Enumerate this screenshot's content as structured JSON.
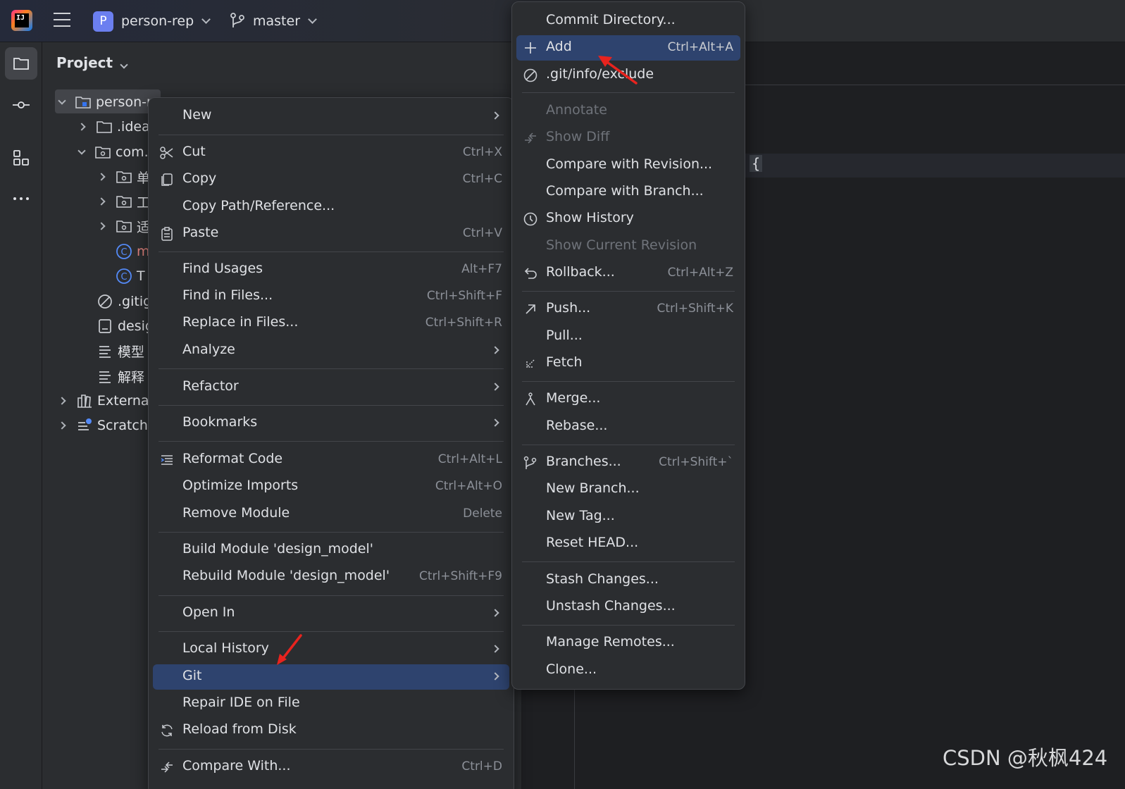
{
  "topbar": {
    "project_badge": "P",
    "project_name": "person-rep",
    "branch_name": "master"
  },
  "project_panel": {
    "title": "Project",
    "tree": [
      {
        "label": "person-r",
        "icon": "module-folder-icon"
      },
      {
        "label": ".idea",
        "icon": "folder-icon"
      },
      {
        "label": "com.",
        "icon": "package-folder-icon"
      },
      {
        "label": "单",
        "icon": "package-folder-icon"
      },
      {
        "label": "工",
        "icon": "package-folder-icon"
      },
      {
        "label": "适",
        "icon": "package-folder-icon"
      },
      {
        "label": "m",
        "icon": "class-icon"
      },
      {
        "label": "T",
        "icon": "class-icon"
      },
      {
        "label": ".gitig",
        "icon": "ignore-file-icon"
      },
      {
        "label": "desig",
        "icon": "module-file-icon"
      },
      {
        "label": "模型",
        "icon": "text-file-icon"
      },
      {
        "label": "解释",
        "icon": "text-file-icon"
      },
      {
        "label": "External",
        "icon": "library-icon"
      },
      {
        "label": "Scratch",
        "icon": "scratches-icon"
      }
    ]
  },
  "context_menu": {
    "items": [
      {
        "label": "New",
        "shortcut": "",
        "submenu": true
      },
      {
        "label": "Cut",
        "shortcut": "Ctrl+X",
        "icon": "scissors-icon"
      },
      {
        "label": "Copy",
        "shortcut": "Ctrl+C",
        "icon": "copy-icon"
      },
      {
        "label": "Copy Path/Reference...",
        "shortcut": ""
      },
      {
        "label": "Paste",
        "shortcut": "Ctrl+V",
        "icon": "paste-icon"
      },
      {
        "label": "Find Usages",
        "shortcut": "Alt+F7"
      },
      {
        "label": "Find in Files...",
        "shortcut": "Ctrl+Shift+F"
      },
      {
        "label": "Replace in Files...",
        "shortcut": "Ctrl+Shift+R"
      },
      {
        "label": "Analyze",
        "shortcut": "",
        "submenu": true
      },
      {
        "label": "Refactor",
        "shortcut": "",
        "submenu": true
      },
      {
        "label": "Bookmarks",
        "shortcut": "",
        "submenu": true
      },
      {
        "label": "Reformat Code",
        "shortcut": "Ctrl+Alt+L",
        "icon": "reformat-icon"
      },
      {
        "label": "Optimize Imports",
        "shortcut": "Ctrl+Alt+O"
      },
      {
        "label": "Remove Module",
        "shortcut": "Delete"
      },
      {
        "label": "Build Module 'design_model'",
        "shortcut": ""
      },
      {
        "label": "Rebuild Module 'design_model'",
        "shortcut": "Ctrl+Shift+F9"
      },
      {
        "label": "Open In",
        "shortcut": "",
        "submenu": true
      },
      {
        "label": "Local History",
        "shortcut": "",
        "submenu": true
      },
      {
        "label": "Git",
        "shortcut": "",
        "submenu": true,
        "highlighted": true
      },
      {
        "label": "Repair IDE on File",
        "shortcut": ""
      },
      {
        "label": "Reload from Disk",
        "shortcut": "",
        "icon": "reload-icon"
      },
      {
        "label": "Compare With...",
        "shortcut": "Ctrl+D",
        "icon": "compare-icon"
      }
    ]
  },
  "git_menu": {
    "items": [
      {
        "label": "Commit Directory...",
        "shortcut": ""
      },
      {
        "label": "Add",
        "shortcut": "Ctrl+Alt+A",
        "icon": "plus-icon",
        "highlighted": true
      },
      {
        "label": ".git/info/exclude",
        "shortcut": "",
        "icon": "ignore-icon"
      },
      {
        "label": "Annotate",
        "shortcut": "",
        "disabled": true
      },
      {
        "label": "Show Diff",
        "shortcut": "",
        "disabled": true,
        "icon": "diff-icon"
      },
      {
        "label": "Compare with Revision...",
        "shortcut": ""
      },
      {
        "label": "Compare with Branch...",
        "shortcut": ""
      },
      {
        "label": "Show History",
        "shortcut": "",
        "icon": "clock-icon"
      },
      {
        "label": "Show Current Revision",
        "shortcut": "",
        "disabled": true
      },
      {
        "label": "Rollback...",
        "shortcut": "Ctrl+Alt+Z",
        "icon": "rollback-icon"
      },
      {
        "label": "Push...",
        "shortcut": "Ctrl+Shift+K",
        "icon": "push-icon"
      },
      {
        "label": "Pull...",
        "shortcut": ""
      },
      {
        "label": "Fetch",
        "shortcut": "",
        "icon": "fetch-icon"
      },
      {
        "label": "Merge...",
        "shortcut": "",
        "icon": "merge-icon"
      },
      {
        "label": "Rebase...",
        "shortcut": ""
      },
      {
        "label": "Branches...",
        "shortcut": "Ctrl+Shift+`",
        "icon": "branch-icon"
      },
      {
        "label": "New Branch...",
        "shortcut": ""
      },
      {
        "label": "New Tag...",
        "shortcut": ""
      },
      {
        "label": "Reset HEAD...",
        "shortcut": ""
      },
      {
        "label": "Stash Changes...",
        "shortcut": ""
      },
      {
        "label": "Unstash Changes...",
        "shortcut": ""
      },
      {
        "label": "Manage Remotes...",
        "shortcut": ""
      },
      {
        "label": "Clone...",
        "shortcut": ""
      }
    ]
  },
  "editor": {
    "brace": "{"
  },
  "watermark": "CSDN @秋枫424"
}
